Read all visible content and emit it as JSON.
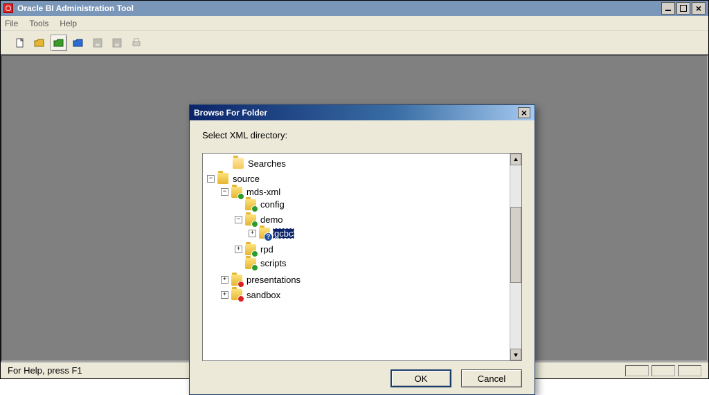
{
  "window": {
    "title": "Oracle BI Administration Tool"
  },
  "menus": {
    "file": "File",
    "tools": "Tools",
    "help": "Help"
  },
  "statusbar": {
    "help_text": "For Help, press F1"
  },
  "dialog": {
    "title": "Browse For Folder",
    "prompt": "Select XML directory:",
    "ok_label": "OK",
    "cancel_label": "Cancel",
    "tree": {
      "searches": "Searches",
      "source": "source",
      "mds_xml": "mds-xml",
      "config": "config",
      "demo": "demo",
      "gcbc": "gcbc",
      "rpd": "rpd",
      "scripts": "scripts",
      "presentations": "presentations",
      "sandbox": "sandbox"
    }
  }
}
